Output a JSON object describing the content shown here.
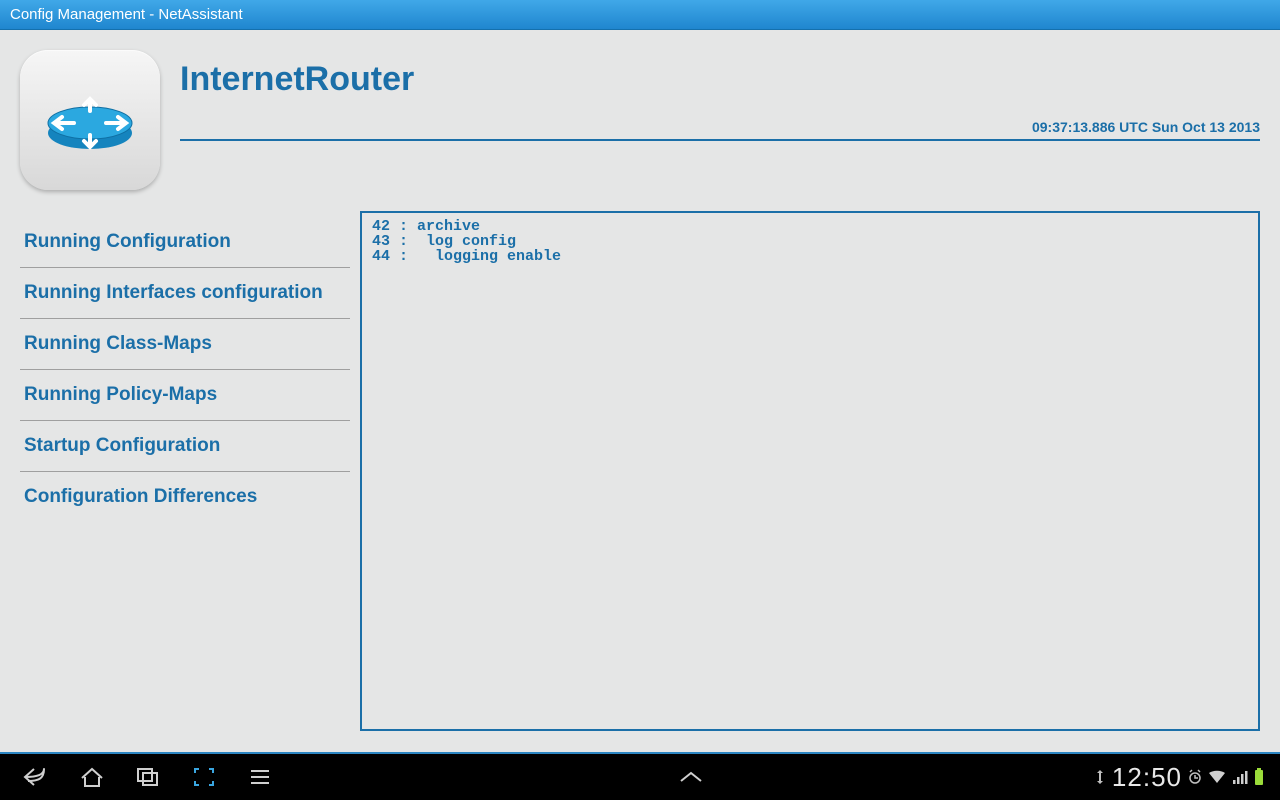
{
  "titlebar": {
    "text": "Config Management - NetAssistant"
  },
  "header": {
    "device_name": "InternetRouter",
    "timestamp": "09:37:13.886 UTC Sun Oct 13 2013"
  },
  "menu": {
    "items": [
      {
        "label": "Running Configuration"
      },
      {
        "label": "Running Interfaces configuration"
      },
      {
        "label": "Running Class-Maps"
      },
      {
        "label": "Running Policy-Maps"
      },
      {
        "label": "Startup Configuration"
      },
      {
        "label": "Configuration Differences"
      }
    ]
  },
  "output": {
    "text": "42 : archive\n43 :  log config\n44 :   logging enable"
  },
  "navbar": {
    "clock": "12:50"
  }
}
